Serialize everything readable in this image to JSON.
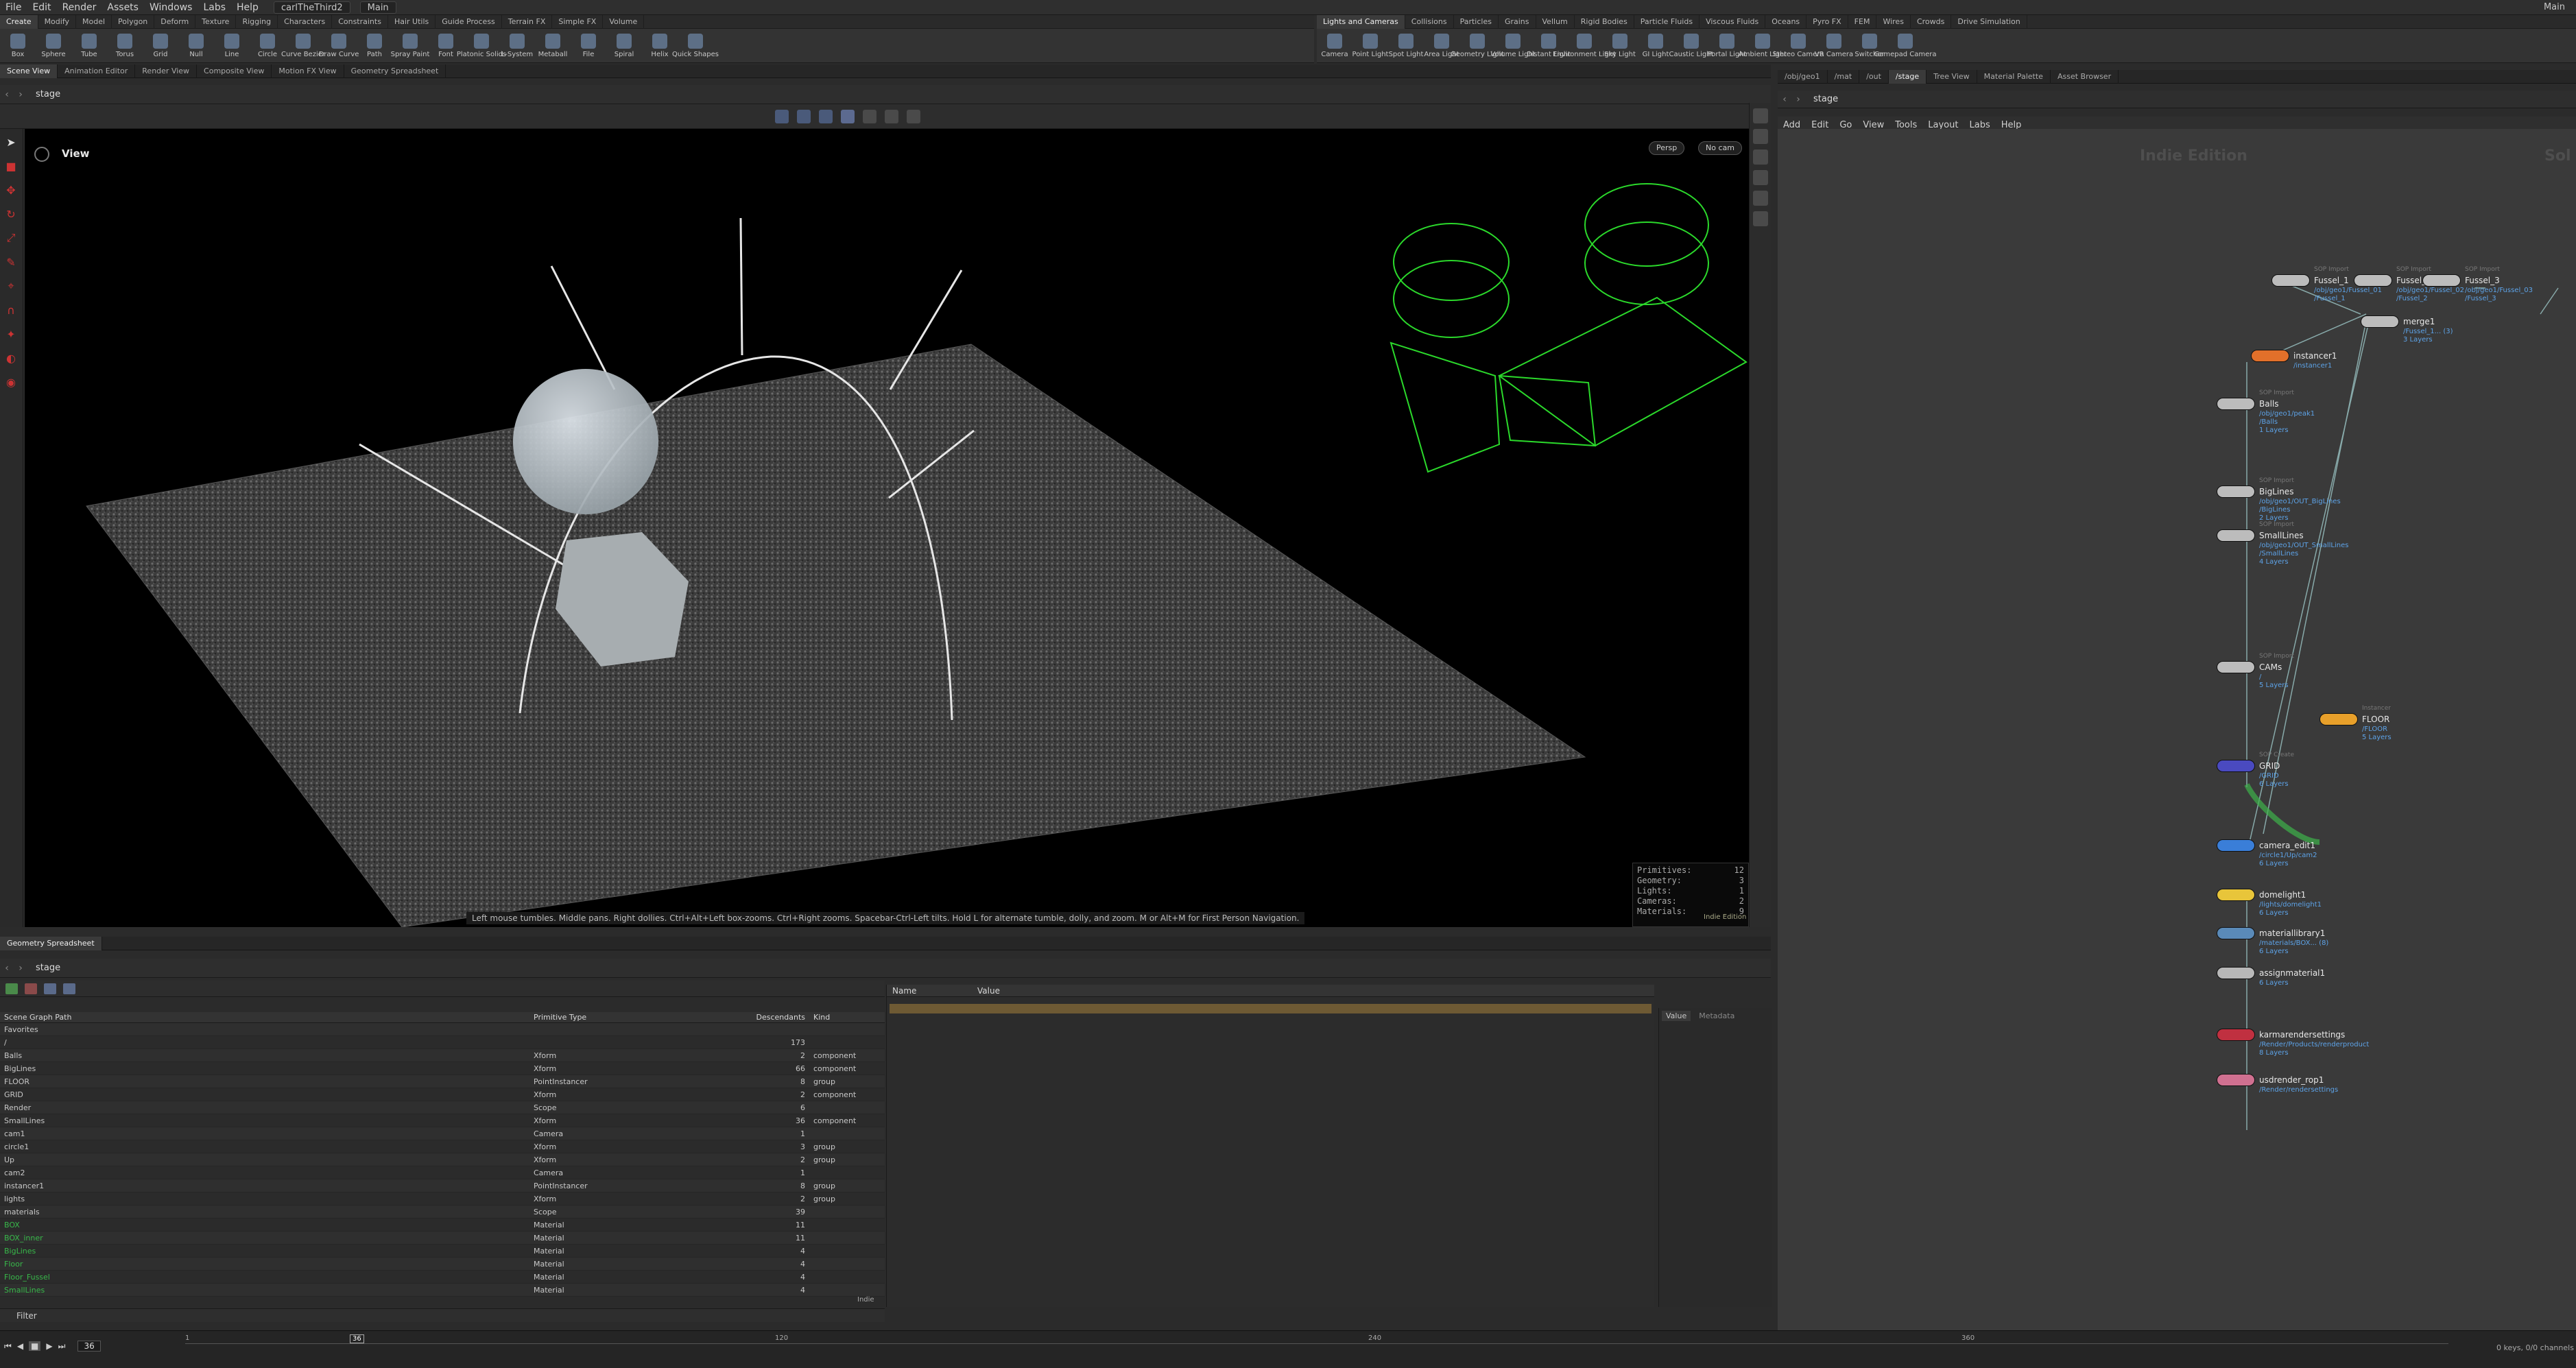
{
  "menubar": {
    "items": [
      "File",
      "Edit",
      "Render",
      "Assets",
      "Windows",
      "Labs",
      "Help"
    ],
    "scene_file": "carlTheThird2",
    "desktop": "Main",
    "title_right": "Main"
  },
  "shelf_left": {
    "tabs": [
      "Create",
      "Modify",
      "Model",
      "Polygon",
      "Deform",
      "Texture",
      "Rigging",
      "Characters",
      "Constraints",
      "Hair Utils",
      "Guide Process",
      "Terrain FX",
      "Simple FX",
      "Volume"
    ],
    "tools": [
      "Box",
      "Sphere",
      "Tube",
      "Torus",
      "Grid",
      "Null",
      "Line",
      "Circle",
      "Curve Bezier",
      "Draw Curve",
      "Path",
      "Spray Paint",
      "Font",
      "Platonic Solids",
      "L-System",
      "Metaball",
      "File",
      "Spiral",
      "Helix",
      "Quick Shapes"
    ]
  },
  "shelf_right": {
    "tabs": [
      "Lights and Cameras",
      "Collisions",
      "Particles",
      "Grains",
      "Vellum",
      "Rigid Bodies",
      "Particle Fluids",
      "Viscous Fluids",
      "Oceans",
      "Pyro FX",
      "FEM",
      "Wires",
      "Crowds",
      "Drive Simulation"
    ],
    "tools": [
      "Camera",
      "Point Light",
      "Spot Light",
      "Area Light",
      "Geometry Light",
      "Volume Light",
      "Distant Light",
      "Environment Light",
      "Sky Light",
      "GI Light",
      "Caustic Light",
      "Portal Light",
      "Ambient Light",
      "Stereo Camera",
      "VR Camera",
      "Switcher",
      "Gamepad Camera"
    ]
  },
  "left_panes": {
    "tabs": [
      "Scene View",
      "Animation Editor",
      "Render View",
      "Composite View",
      "Motion FX View",
      "Geometry Spreadsheet"
    ],
    "path": "stage"
  },
  "viewport": {
    "label": "View",
    "persp": "Persp",
    "cam": "No cam",
    "hint": "Left mouse tumbles. Middle pans. Right dollies. Ctrl+Alt+Left box-zooms. Ctrl+Right zooms. Spacebar-Ctrl-Left tilts. Hold L for alternate tumble, dolly, and zoom. M or Alt+M for First Person Navigation.",
    "stats": [
      [
        "Primitives:",
        "12"
      ],
      [
        "Geometry:",
        "3"
      ],
      [
        "Lights:",
        "1"
      ],
      [
        "Cameras:",
        "2"
      ],
      [
        "Materials:",
        "9"
      ]
    ],
    "edition": "Indie Edition"
  },
  "right_panes": {
    "tabs": [
      "/obj/geo1",
      "/mat",
      "/out",
      "/stage",
      "Tree View",
      "Material Palette",
      "Asset Browser"
    ],
    "path": "stage",
    "menu": [
      "Add",
      "Edit",
      "Go",
      "View",
      "Tools",
      "Layout",
      "Labs",
      "Help"
    ],
    "watermark": "Indie Edition",
    "watermark2": "Sol"
  },
  "nodes": [
    {
      "name": "Fussel_1",
      "sub": "/obj/geo1/Fussel_01\n/Fussel_1",
      "type": "SOP Import",
      "color": "#bcbcbc"
    },
    {
      "name": "Fussel_2",
      "sub": "/obj/geo1/Fussel_02\n/Fussel_2",
      "type": "SOP Import",
      "color": "#bcbcbc"
    },
    {
      "name": "Fussel_3",
      "sub": "/obj/geo1/Fussel_03\n/Fussel_3",
      "type": "SOP Import",
      "color": "#bcbcbc"
    },
    {
      "name": "merge1",
      "sub": "/Fussel_1... (3)\n3 Layers",
      "type": "",
      "color": "#bcbcbc"
    },
    {
      "name": "instancer1",
      "sub": "/instancer1",
      "type": "",
      "color": "#e2702a"
    },
    {
      "name": "Balls",
      "sub": "/obj/geo1/peak1\n/Balls\n1 Layers",
      "type": "SOP Import",
      "color": "#bcbcbc"
    },
    {
      "name": "BigLines",
      "sub": "/obj/geo1/OUT_BigLines\n/BigLines\n2 Layers",
      "type": "SOP Import",
      "color": "#bcbcbc"
    },
    {
      "name": "SmallLines",
      "sub": "/obj/geo1/OUT_SmallLines\n/SmallLines\n4 Layers",
      "type": "SOP Import",
      "color": "#bcbcbc"
    },
    {
      "name": "CAMs",
      "sub": "/\n5 Layers",
      "type": "SOP Import",
      "color": "#bcbcbc"
    },
    {
      "name": "FLOOR",
      "sub": "/FLOOR\n5 Layers",
      "type": "Instancer",
      "color": "#e8a02a"
    },
    {
      "name": "GRID",
      "sub": "/GRID\n6 Layers",
      "type": "SOP Create",
      "color": "#4a4ac0"
    },
    {
      "name": "camera_edit1",
      "sub": "/circle1/Up/cam2\n6 Layers",
      "type": "",
      "color": "#3a7ed8"
    },
    {
      "name": "domelight1",
      "sub": "/lights/domelight1\n6 Layers",
      "type": "",
      "color": "#e8c53a"
    },
    {
      "name": "materiallibrary1",
      "sub": "/materials/BOX... (8)\n6 Layers",
      "type": "",
      "color": "#5a8ab8"
    },
    {
      "name": "assignmaterial1",
      "sub": "6 Layers",
      "type": "",
      "color": "#b8b8b8"
    },
    {
      "name": "karmarendersettings",
      "sub": "/Render/Products/renderproduct\n8 Layers",
      "type": "",
      "color": "#c03040"
    },
    {
      "name": "usdrender_rop1",
      "sub": "/Render/rendersettings",
      "type": "",
      "color": "#d07090"
    }
  ],
  "spreadsheet": {
    "tab": "Geometry Spreadsheet",
    "path": "stage",
    "headers": [
      "Scene Graph Path",
      "Primitive Type",
      "Descendants",
      "Kind"
    ],
    "rows": [
      {
        "path": "Favorites",
        "type": "",
        "desc": "",
        "kind": "",
        "mat": false
      },
      {
        "path": "/",
        "type": "",
        "desc": "173",
        "kind": "",
        "mat": false
      },
      {
        "path": "Balls",
        "type": "Xform",
        "desc": "2",
        "kind": "component",
        "mat": false
      },
      {
        "path": "BigLines",
        "type": "Xform",
        "desc": "66",
        "kind": "component",
        "mat": false
      },
      {
        "path": "FLOOR",
        "type": "PointInstancer",
        "desc": "8",
        "kind": "group",
        "mat": false
      },
      {
        "path": "GRID",
        "type": "Xform",
        "desc": "2",
        "kind": "component",
        "mat": false
      },
      {
        "path": "Render",
        "type": "Scope",
        "desc": "6",
        "kind": "",
        "mat": false
      },
      {
        "path": "SmallLines",
        "type": "Xform",
        "desc": "36",
        "kind": "component",
        "mat": false
      },
      {
        "path": "cam1",
        "type": "Camera",
        "desc": "1",
        "kind": "",
        "mat": false
      },
      {
        "path": "circle1",
        "type": "Xform",
        "desc": "3",
        "kind": "group",
        "mat": false
      },
      {
        "path": "Up",
        "type": "Xform",
        "desc": "2",
        "kind": "group",
        "mat": false
      },
      {
        "path": "cam2",
        "type": "Camera",
        "desc": "1",
        "kind": "",
        "mat": false
      },
      {
        "path": "instancer1",
        "type": "PointInstancer",
        "desc": "8",
        "kind": "group",
        "mat": false
      },
      {
        "path": "lights",
        "type": "Xform",
        "desc": "2",
        "kind": "group",
        "mat": false
      },
      {
        "path": "materials",
        "type": "Scope",
        "desc": "39",
        "kind": "",
        "mat": false
      },
      {
        "path": "BOX",
        "type": "Material",
        "desc": "11",
        "kind": "",
        "mat": true
      },
      {
        "path": "BOX_inner",
        "type": "Material",
        "desc": "11",
        "kind": "",
        "mat": true
      },
      {
        "path": "BigLines",
        "type": "Material",
        "desc": "4",
        "kind": "",
        "mat": true
      },
      {
        "path": "Floor",
        "type": "Material",
        "desc": "4",
        "kind": "",
        "mat": true
      },
      {
        "path": "Floor_Fussel",
        "type": "Material",
        "desc": "4",
        "kind": "",
        "mat": true
      },
      {
        "path": "SmallLines",
        "type": "Material",
        "desc": "4",
        "kind": "",
        "mat": true
      }
    ],
    "indie": "Indie",
    "filter": "Filter"
  },
  "props": {
    "headers": [
      "Name",
      "Value"
    ],
    "tabs": [
      "Value",
      "Metadata"
    ]
  },
  "timeline": {
    "frame": "36",
    "ticks": [
      "1",
      "36",
      "120",
      "240",
      "360"
    ],
    "status": "0 keys, 0/0 channels"
  }
}
